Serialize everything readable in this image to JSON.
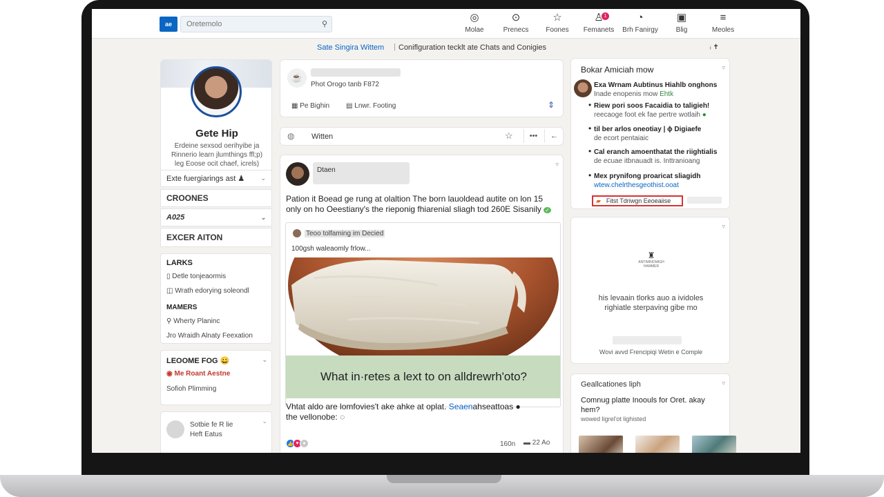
{
  "nav": {
    "logo": "ae",
    "search_placeholder": "Oretemolo",
    "items": [
      {
        "icon": "◎",
        "label": "Molae",
        "badge": ""
      },
      {
        "icon": "⊙",
        "label": "Prenecs",
        "badge": ""
      },
      {
        "icon": "☆",
        "label": "Foones",
        "badge": ""
      },
      {
        "icon": "♙",
        "label": "Femanets",
        "badge": "1"
      },
      {
        "icon": "◔",
        "label": "Brh Fanirgy",
        "badge": ""
      },
      {
        "icon": "▣",
        "label": "Blig",
        "badge": ""
      },
      {
        "icon": "≡",
        "label": "Meoles",
        "badge": ""
      }
    ]
  },
  "announce": {
    "link": "Sate Singira Wittem",
    "separator": "|",
    "text": "Coniflguration tecklt ate Chats and Conigies",
    "end": "ᵢ ✝"
  },
  "left": {
    "profile_name": "Gete Hip",
    "profile_headline": "Erdeine sexsod oerihyibe ja Rinnerio learn jlumthings ffl;p) leg Eoose ocit chaef, icrels)",
    "row1": "Exte fuergiarings ast ♟",
    "row2": "CROONES",
    "row3": "A025",
    "row4": "EXCER AITON",
    "sec1_head1": "LARKS",
    "sec1_line1": "Detle tonjeaormis",
    "sec1_line2": "Wrath edorying soleondl",
    "sec1_head2": "MAMERS",
    "sec1_line3": "Wherty Planinc",
    "sec1_line4": "Jro Wraidh Alnaty Feexation",
    "sec2_head": "LEOOME FOG 😀",
    "sec2_line1": "Me Roant Aestne",
    "sec2_line2": "Sofioh Plimming",
    "bb_line1": "Sotbie fe R lie",
    "bb_line2": "Heft Eatus"
  },
  "compose": {
    "sub": "Phot Orogo tanb F872",
    "action1": "Pe Bighin",
    "action2": "Lnwr. Footing"
  },
  "filter": {
    "label": "Witten"
  },
  "post": {
    "author": "Dtaen",
    "text": "Pation it Boead ge rung at olaltion The born lauoldead autite on lon 15 only on ho Oeestiany's the rieponig fhiarenial sliagh tod 260E Sisanily",
    "shared_head": "Teoo tolfaming im Decied",
    "shared_sub": "100gsh waleaomly frlow...",
    "caption": "What in·retes a lext to on alldrewrh'oto?",
    "foot_text": "Vhtat aldo are lomfovies't ake ahke at oplat.",
    "foot_link": "Seaen",
    "foot_link_rest": "ahseattoas",
    "foot_line2": "the vellonobe:",
    "count": "160n",
    "comments": "22 Ao"
  },
  "news": {
    "title": "Bokar Amiciah mow",
    "items": [
      {
        "title": "Exa Wrnam Aubtinus Hiahlb onghons",
        "sub": "Inade enopenis mow",
        "accent": "Ehtk"
      },
      {
        "title": "Riew pori soos Facaidia to taligieh!",
        "sub": "reecaoge foot ek fae pertre wotlaih",
        "accent": ""
      },
      {
        "title": "til ber arlos oneotiay | ɸ Digiaefe",
        "sub": "de ecort pentaiaic",
        "accent": ""
      },
      {
        "title": "Cal eranch amoenthatat the riightialis",
        "sub": "de ecuae itbnauadt is. Inttranioang",
        "accent": ""
      },
      {
        "title": "Mex prynifong proaricat sliagidh",
        "sub": "wtew.chelrthesgeothist.ooat",
        "accent": ""
      }
    ],
    "promo": "Fitst Tdriwgn Eeoeaiise"
  },
  "ad": {
    "logo_text": "ANTIMINOMIGH HAMMER",
    "text": "his levaain tlorks auo a ividoles righiatle sterpaving gibe mo",
    "foot": "Wovi avvd Frencipiqi Wetin e Comple"
  },
  "suggest": {
    "title": "Geallcationes liph",
    "headline": "Comnug platte Inoouls for Oret. akay hem?",
    "sub": "wowed ligrel'ot lighisted"
  },
  "colors": {
    "brand": "#0a66c2",
    "promo_border": "#d63232",
    "badge": "#e0245e"
  }
}
